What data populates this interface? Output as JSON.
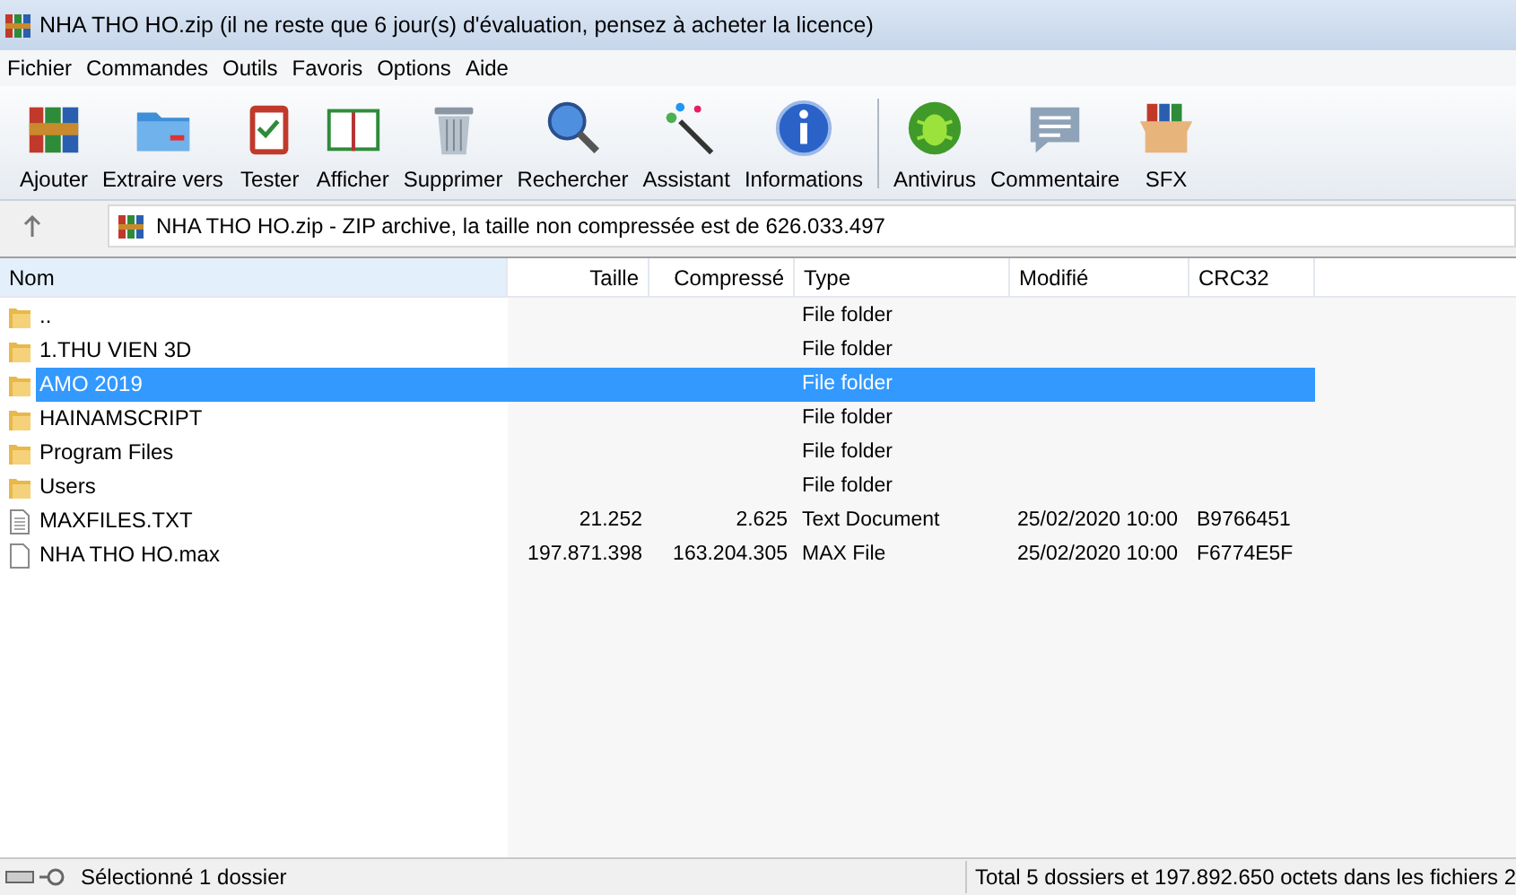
{
  "window": {
    "title": "NHA THO HO.zip (il ne reste que 6 jour(s) d'évaluation, pensez à acheter la licence)"
  },
  "menu": [
    "Fichier",
    "Commandes",
    "Outils",
    "Favoris",
    "Options",
    "Aide"
  ],
  "toolbar": {
    "groups": [
      [
        {
          "label": "Ajouter",
          "kind": "add"
        },
        {
          "label": "Extraire vers",
          "kind": "extract"
        },
        {
          "label": "Tester",
          "kind": "test"
        },
        {
          "label": "Afficher",
          "kind": "view"
        },
        {
          "label": "Supprimer",
          "kind": "delete"
        },
        {
          "label": "Rechercher",
          "kind": "find"
        },
        {
          "label": "Assistant",
          "kind": "wizard"
        },
        {
          "label": "Informations",
          "kind": "info"
        }
      ],
      [
        {
          "label": "Antivirus",
          "kind": "virus"
        },
        {
          "label": "Commentaire",
          "kind": "comment"
        },
        {
          "label": "SFX",
          "kind": "sfx"
        }
      ]
    ]
  },
  "address_bar": {
    "path": "NHA THO HO.zip - ZIP archive, la taille non compressée est de 626.033.497"
  },
  "table": {
    "columns": [
      "Nom",
      "Taille",
      "Compressé",
      "Type",
      "Modifié",
      "CRC32"
    ],
    "rows": [
      {
        "kind": "folder",
        "selected": false,
        "cells": [
          "..",
          "",
          "",
          "File folder",
          "",
          ""
        ]
      },
      {
        "kind": "folder",
        "selected": false,
        "cells": [
          "1.THU VIEN 3D",
          "",
          "",
          "File folder",
          "",
          ""
        ]
      },
      {
        "kind": "folder",
        "selected": true,
        "cells": [
          "AMO 2019",
          "",
          "",
          "File folder",
          "",
          ""
        ]
      },
      {
        "kind": "folder",
        "selected": false,
        "cells": [
          "HAINAMSCRIPT",
          "",
          "",
          "File folder",
          "",
          ""
        ]
      },
      {
        "kind": "folder",
        "selected": false,
        "cells": [
          "Program Files",
          "",
          "",
          "File folder",
          "",
          ""
        ]
      },
      {
        "kind": "folder",
        "selected": false,
        "cells": [
          "Users",
          "",
          "",
          "File folder",
          "",
          ""
        ]
      },
      {
        "kind": "text",
        "selected": false,
        "cells": [
          "MAXFILES.TXT",
          "21.252",
          "2.625",
          "Text Document",
          "25/02/2020 10:00",
          "B9766451"
        ]
      },
      {
        "kind": "file",
        "selected": false,
        "cells": [
          "NHA THO HO.max",
          "197.871.398",
          "163.204.305",
          "MAX File",
          "25/02/2020 10:00",
          "F6774E5F"
        ]
      }
    ]
  },
  "status_bar": {
    "left": "Sélectionné 1 dossier",
    "right": "Total 5 dossiers et 197.892.650 octets dans les fichiers 2"
  }
}
